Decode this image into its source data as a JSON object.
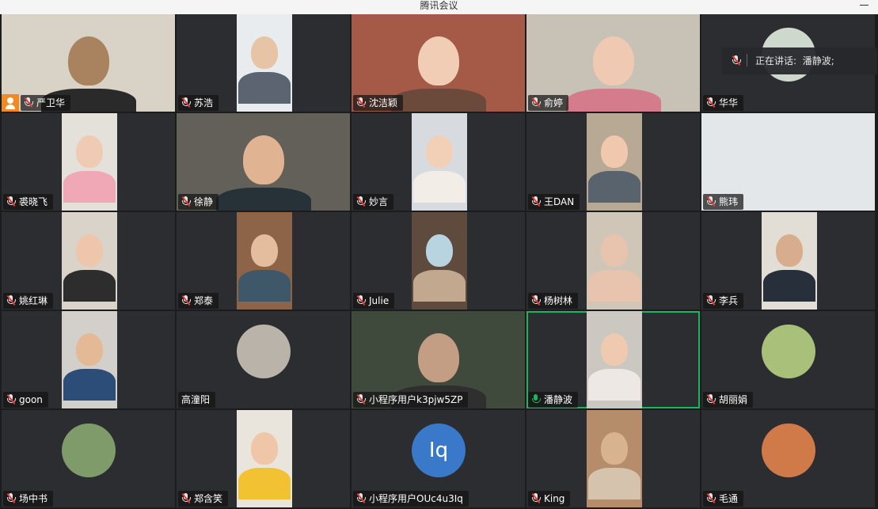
{
  "window": {
    "title": "腾讯会议"
  },
  "speaking": {
    "label": "正在讲话:",
    "name": "潘静波;"
  },
  "tiles": [
    {
      "name": "严卫华",
      "host": true,
      "video": "wide",
      "bg": "#d9d2c6",
      "skin": "#a9825f",
      "shirt": "#2a2a2a"
    },
    {
      "name": "苏浩",
      "video": "narrow",
      "bg": "#e9ecef",
      "skin": "#e7c4a6",
      "shirt": "#5b6470"
    },
    {
      "name": "沈洁颖",
      "video": "wide",
      "bg": "#a55a48",
      "skin": "#f0cdb4",
      "shirt": "#6b4a3b"
    },
    {
      "name": "俞婷",
      "video": "wide",
      "bg": "#c7c1b6",
      "skin": "#efc9b2",
      "shirt": "#d47c8b"
    },
    {
      "name": "华华",
      "video": "avatar",
      "avatar": "#cfd8cc"
    },
    {
      "name": "裘晓飞",
      "video": "narrow",
      "bg": "#e4e1db",
      "skin": "#f0cbb4",
      "shirt": "#f0a8b7"
    },
    {
      "name": "徐静",
      "video": "wide",
      "bg": "#626058",
      "skin": "#e0b493",
      "shirt": "#263238"
    },
    {
      "name": "妙言",
      "video": "narrow",
      "bg": "#d7dbe0",
      "skin": "#f2cfb7",
      "shirt": "#f2ede6"
    },
    {
      "name": "王DAN",
      "video": "narrow",
      "bg": "#b7a994",
      "skin": "#efc8ad",
      "shirt": "#59636d"
    },
    {
      "name": "熊玮",
      "video": "wide",
      "bg": "#e3e7ea",
      "skin": "#e3e7ea",
      "shirt": "#e3e7ea",
      "empty": true
    },
    {
      "name": "姚红琳",
      "video": "narrow",
      "bg": "#d9d3c9",
      "skin": "#eec6ab",
      "shirt": "#2d2d2d"
    },
    {
      "name": "郑泰",
      "video": "narrow",
      "bg": "#8e6448",
      "skin": "#e4bc9e",
      "shirt": "#3f5869"
    },
    {
      "name": "Julie",
      "video": "narrow",
      "bg": "#5e4b3e",
      "skin": "#b8d4e0",
      "shirt": "#c2a88f"
    },
    {
      "name": "杨树林",
      "video": "narrow",
      "bg": "#cfc6b8",
      "skin": "#e8c4ae",
      "shirt": "#e8c4ae"
    },
    {
      "name": "李兵",
      "video": "narrow",
      "bg": "#e2ddd5",
      "skin": "#d8ad8d",
      "shirt": "#27303a"
    },
    {
      "name": "goon",
      "video": "narrow",
      "bg": "#d3d0cc",
      "skin": "#e4b995",
      "shirt": "#2c4d78"
    },
    {
      "name": "高潼阳",
      "video": "avatar",
      "avatar": "#b9b3aa",
      "noMic": true
    },
    {
      "name": "小程序用户k3pjw5ZP",
      "video": "wide",
      "bg": "#3f4a3c",
      "skin": "#c49e84",
      "shirt": "#2f2f2f"
    },
    {
      "name": "潘静波",
      "video": "narrow",
      "bg": "#cbc7c1",
      "skin": "#efc9b0",
      "shirt": "#eee8e4",
      "active": true,
      "micOn": true
    },
    {
      "name": "胡丽娟",
      "video": "avatar",
      "avatar": "#a8c07a"
    },
    {
      "name": "场中书",
      "video": "avatar",
      "avatar": "#7f9b6a"
    },
    {
      "name": "郑含笑",
      "video": "narrow",
      "bg": "#e9e4dc",
      "skin": "#efc6a8",
      "shirt": "#f2c232"
    },
    {
      "name": "小程序用户OUc4u3Iq",
      "video": "text",
      "initials": "Iq"
    },
    {
      "name": "King",
      "video": "narrow",
      "bg": "#b68d6b",
      "skin": "#d9b38f",
      "shirt": "#d5c3ad"
    },
    {
      "name": "毛通",
      "video": "avatar",
      "avatar": "#d07a4a"
    }
  ],
  "colors": {
    "tileBg": "#2b2d30",
    "activeBorder": "#1bb55c",
    "hostBadge": "#f08b23",
    "mutedSlash": "#e23a3a",
    "textAvatar": "#3a79c9"
  }
}
